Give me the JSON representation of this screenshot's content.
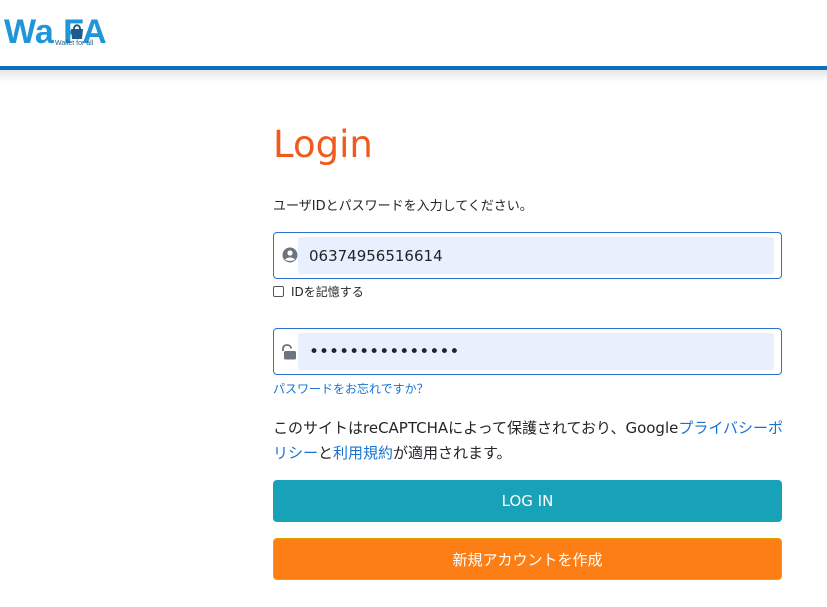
{
  "header": {
    "logo_text": "Wa FA",
    "logo_sub": "Wallet for all",
    "brand_color": "#1e96d7",
    "bar_color": "#0d6ebd"
  },
  "login": {
    "title": "Login",
    "instruction": "ユーザIDとパスワードを入力してください。",
    "user_id_value": "06374956516614",
    "user_icon": "user-circle-icon",
    "remember_label": "IDを記憶する",
    "remember_checked": false,
    "password_value": "•••••••••••••••",
    "password_icon": "unlock-icon",
    "forgot_link": "パスワードをお忘れですか？",
    "recaptcha": {
      "prefix": "このサイトはreCAPTCHAによって保護されており、Google",
      "privacy_link": "プライバシーポリシー",
      "and": "と",
      "terms_link": "利用規約",
      "suffix": "が適用されます。"
    },
    "login_button": "LOG IN",
    "signup_button": "新規アカウントを作成",
    "title_color": "#f05a1e",
    "login_color": "#17a2b8",
    "signup_color": "#fd7e14",
    "link_color": "#1a73d0"
  }
}
